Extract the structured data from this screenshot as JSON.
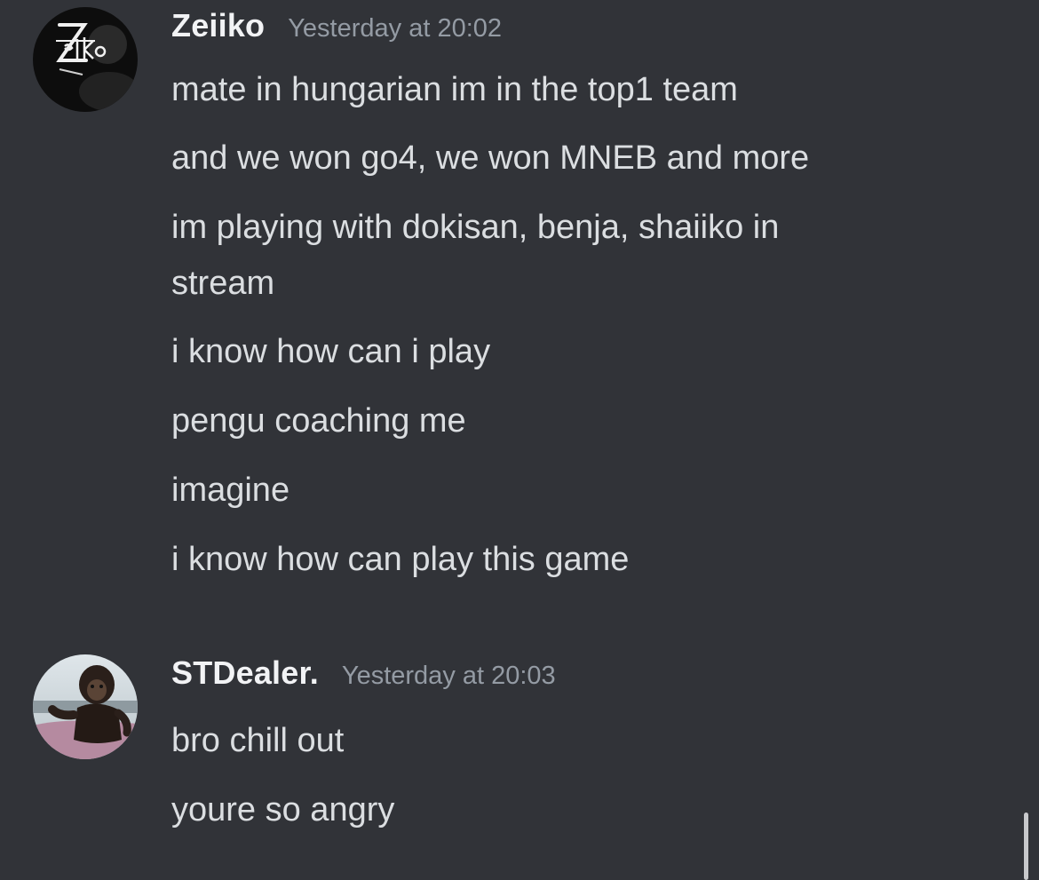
{
  "messages": [
    {
      "author": "Zeiiko",
      "timestamp": "Yesterday at 20:02",
      "avatar": {
        "icon": "zeiiko-logo-avatar",
        "logo_text": "Zeiko"
      },
      "lines": [
        "mate in hungarian im in the top1 team",
        "and we won go4, we won MNEB and more",
        "im playing with dokisan, benja, shaiiko in",
        "stream",
        "i know how can i play",
        "pengu coaching me",
        "imagine",
        "i know how can play this game"
      ]
    },
    {
      "author": "STDealer.",
      "timestamp": "Yesterday at 20:03",
      "avatar": {
        "icon": "chimpanzee-photo-avatar"
      },
      "lines": [
        "bro chill out",
        "youre so angry"
      ]
    }
  ],
  "colors": {
    "background": "#313338",
    "username": "#f2f3f5",
    "timestamp": "#949ba4",
    "message_text": "#dbdee1",
    "scrollbar": "#c8c9cc"
  }
}
